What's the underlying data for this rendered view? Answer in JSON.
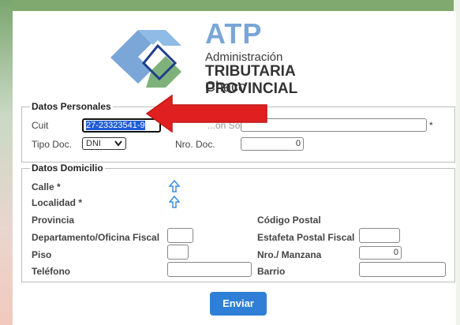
{
  "logo": {
    "acronym": "ATP",
    "line1": "Administración",
    "line2": "TRIBUTARIA PROVINCIAL",
    "line3": "Chaco",
    "colors": {
      "accent_blue": "#7aa6d8",
      "accent_green": "#7fb27a",
      "dark_blue": "#1f3f8a"
    }
  },
  "datos_personales": {
    "legend": "Datos Personales",
    "cuit_label": "Cuit",
    "cuit_value": "27-23323541-9",
    "required_mark": "*",
    "nombre_label_partial": "...ón Social",
    "tipo_doc_label": "Tipo Doc.",
    "tipo_doc_selected": "DNI",
    "nro_doc_label": "Nro. Doc.",
    "nro_doc_value": "0"
  },
  "datos_domicilio": {
    "legend": "Datos Domicilio",
    "calle_label": "Calle *",
    "localidad_label": "Localidad *",
    "provincia_label": "Provincia",
    "codigo_postal_label": "Código Postal",
    "departamento_label": "Departamento/Oficina Fiscal",
    "estafeta_label": "Estafeta Postal Fiscal",
    "piso_label": "Piso",
    "nro_manzana_label": "Nro./ Manzana",
    "nro_manzana_value": "0",
    "telefono_label": "Teléfono",
    "barrio_label": "Barrio"
  },
  "actions": {
    "submit_label": "Enviar",
    "submit_color": "#2f7fd6"
  },
  "annotation": {
    "arrow_color": "#e02020"
  }
}
